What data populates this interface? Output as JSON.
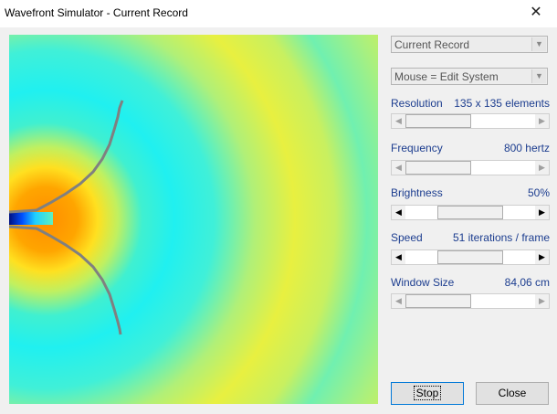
{
  "window": {
    "title": "Wavefront Simulator - Current Record",
    "close_glyph": "✕"
  },
  "simulation": {
    "colors": {
      "background": "#e4ee44",
      "wave_cyan": "#2ef0ee",
      "source_orange": "#ff9a10",
      "barrier": "#808080"
    }
  },
  "panel": {
    "record_select": {
      "value": "Current Record"
    },
    "mouse_select": {
      "value": "Mouse = Edit System"
    },
    "resolution": {
      "label": "Resolution",
      "value": "135 x 135 elements"
    },
    "frequency": {
      "label": "Frequency",
      "value": "800 hertz"
    },
    "brightness": {
      "label": "Brightness",
      "value": "50%"
    },
    "speed": {
      "label": "Speed",
      "value": "51 iterations / frame"
    },
    "window_size": {
      "label": "Window Size",
      "value": "84,06 cm"
    },
    "stop_label": "Stop",
    "close_label": "Close",
    "arrows": {
      "left": "◀",
      "right": "▶",
      "down": "▼"
    },
    "slider_levels": {
      "resolution": 0.0,
      "frequency": 0.0,
      "brightness": 0.5,
      "speed": 0.5,
      "window_size": 0.0
    }
  }
}
